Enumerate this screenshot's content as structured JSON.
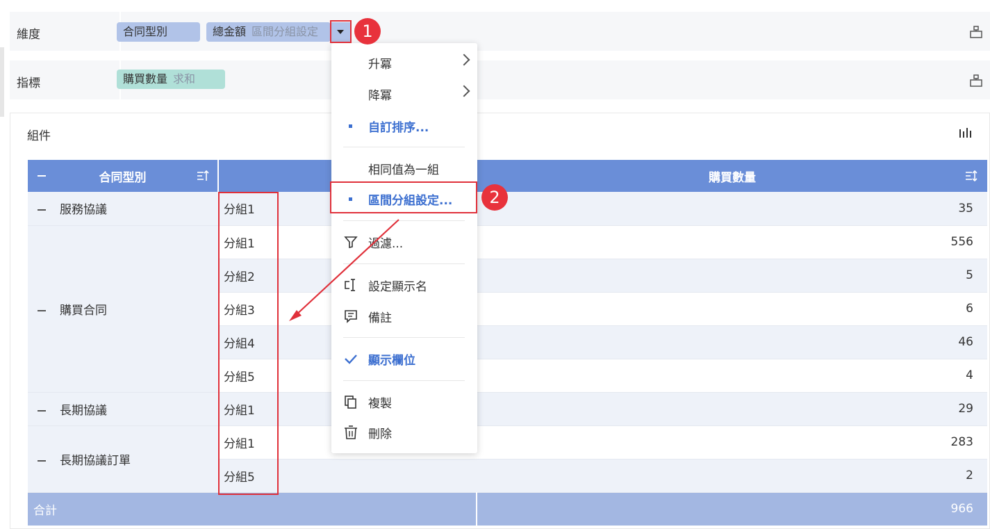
{
  "shelves": {
    "dimension_label": "維度",
    "metric_label": "指標",
    "dimension_fields": [
      {
        "name": "合同型別",
        "sub": ""
      },
      {
        "name": "總金額",
        "sub": "區間分組設定"
      }
    ],
    "metric_fields": [
      {
        "name": "購買數量",
        "sub": "求和"
      }
    ]
  },
  "widget": {
    "title": "組件"
  },
  "table": {
    "headers": [
      "合同型別",
      "",
      "購買數量"
    ],
    "rows": [
      {
        "type": "服務協議",
        "group": "分組1",
        "value": "35"
      },
      {
        "type": "購買合同",
        "group": "分組1",
        "value": "556"
      },
      {
        "type": "",
        "group": "分組2",
        "value": "5"
      },
      {
        "type": "",
        "group": "分組3",
        "value": "6"
      },
      {
        "type": "",
        "group": "分組4",
        "value": "46"
      },
      {
        "type": "",
        "group": "分組5",
        "value": "4"
      },
      {
        "type": "長期協議",
        "group": "分組1",
        "value": "29"
      },
      {
        "type": "長期協議訂單",
        "group": "分組1",
        "value": "283"
      },
      {
        "type": "",
        "group": "分組5",
        "value": "2"
      }
    ],
    "total_label": "合計",
    "total_value": "966"
  },
  "menu": {
    "items": [
      {
        "label": "升冪"
      },
      {
        "label": "降冪"
      },
      {
        "label": "自訂排序..."
      },
      {
        "label": "相同值為一組"
      },
      {
        "label": "區間分組設定..."
      },
      {
        "label": "過濾..."
      },
      {
        "label": "設定顯示名"
      },
      {
        "label": "備註"
      },
      {
        "label": "顯示欄位"
      },
      {
        "label": "複製"
      },
      {
        "label": "刪除"
      }
    ]
  },
  "annotations": {
    "step1": "1",
    "step2": "2"
  },
  "colors": {
    "header": "#6a8ed8",
    "accent": "#3c6fd0",
    "annotation": "#e0303a",
    "total_row": "#a3b7e2"
  }
}
